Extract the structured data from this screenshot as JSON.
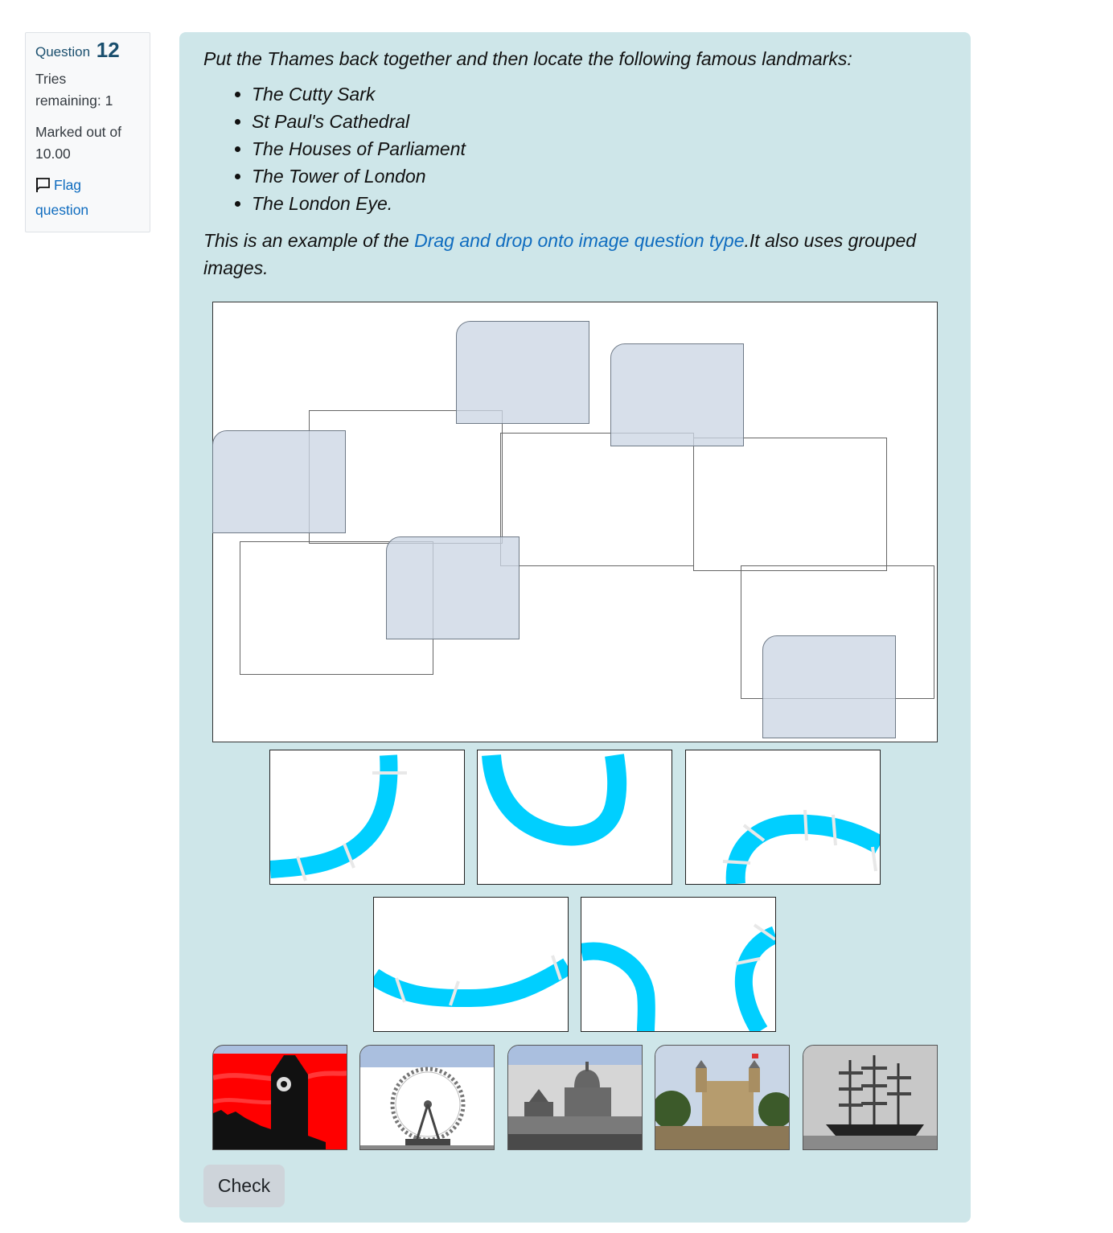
{
  "question_info": {
    "question_label": "Question",
    "question_number": "12",
    "tries_line1": "Tries",
    "tries_line2": "remaining: 1",
    "marked_line1": "Marked out of",
    "marked_line2": "10.00",
    "flag_line1": "Flag",
    "flag_line2": "question"
  },
  "question_text": {
    "intro": "Put the Thames back together and then locate the following famous landmarks:",
    "landmarks": [
      "The Cutty Sark",
      "St Paul's Cathedral",
      "The Houses of Parliament",
      "The Tower of London",
      "The London Eye."
    ],
    "example_prefix": "This is an example of the ",
    "example_link": "Drag and drop onto image question type",
    "example_suffix": ".It also uses grouped images."
  },
  "drag_items": {
    "river_pieces": [
      "river-piece-1",
      "river-piece-2",
      "river-piece-3",
      "river-piece-4",
      "river-piece-5"
    ],
    "landmark_images": [
      "big-ben",
      "london-eye",
      "st-pauls-cathedral",
      "tower-of-london",
      "cutty-sark"
    ]
  },
  "colors": {
    "panel_background": "#cee6e9",
    "river": "#00cfff",
    "link": "#0f6cbf",
    "dropzone_fill": "#d6dfea"
  },
  "actions": {
    "check_label": "Check"
  }
}
